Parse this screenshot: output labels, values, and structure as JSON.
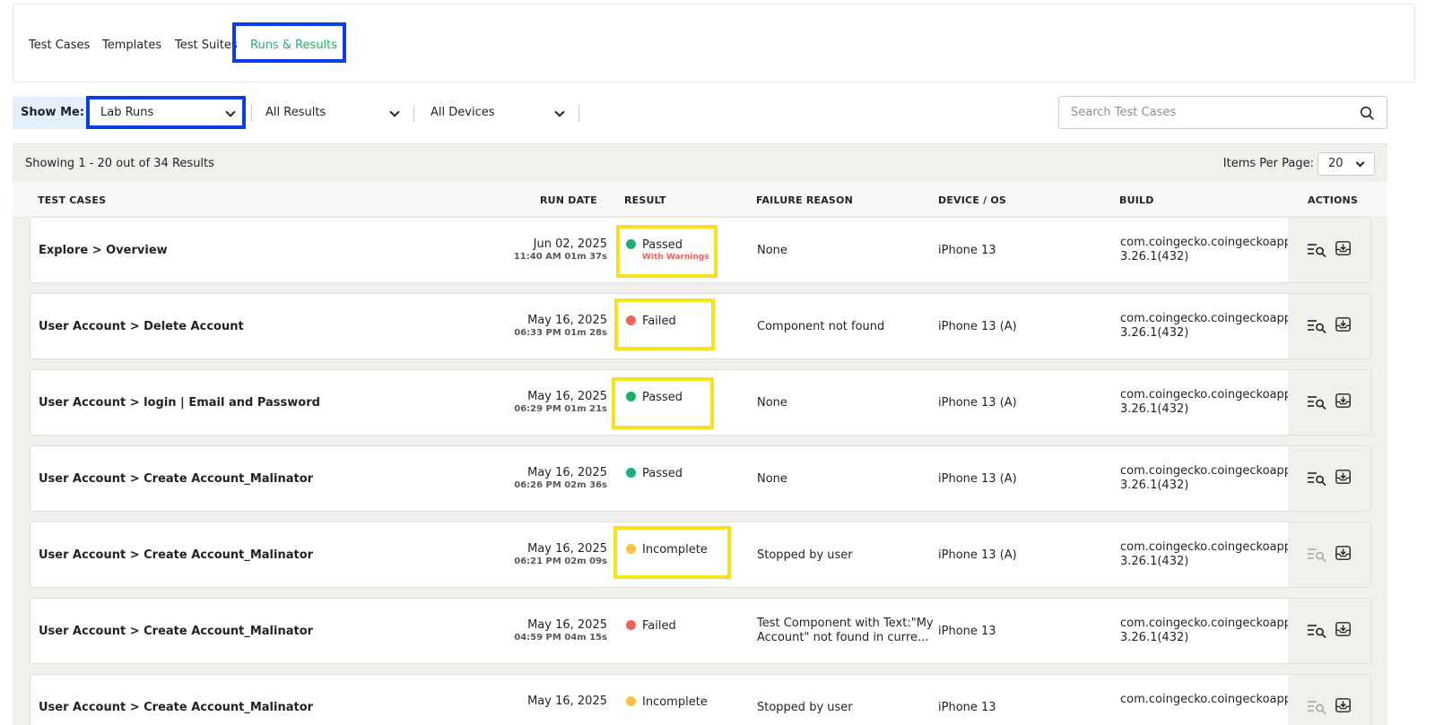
{
  "tabs": [
    {
      "label": "Test Cases",
      "active": false
    },
    {
      "label": "Templates",
      "active": false
    },
    {
      "label": "Test Suites",
      "active": false
    },
    {
      "label": "Runs & Results",
      "active": true
    }
  ],
  "filters": {
    "show_me_label": "Show Me:",
    "run_type": "Lab Runs",
    "results": "All Results",
    "devices": "All Devices",
    "search_placeholder": "Search Test Cases"
  },
  "summary": {
    "showing": "Showing 1 - 20 out of 34 Results",
    "items_per_page_label": "Items Per Page:",
    "items_per_page": "20"
  },
  "columns": {
    "test_cases": "TEST CASES",
    "run_date": "RUN DATE",
    "result": "RESULT",
    "failure_reason": "FAILURE REASON",
    "device_os": "DEVICE / OS",
    "build": "BUILD",
    "actions": "ACTIONS"
  },
  "rows": [
    {
      "name": "Explore > Overview",
      "date": "Jun 02, 2025",
      "time": "11:40 AM 01m 37s",
      "result": "Passed",
      "status": "passed",
      "warning": "With Warnings",
      "reason": "None",
      "device": "iPhone 13",
      "build_line1": "com.coingecko.coingeckoapp",
      "build_line2": "3.26.1(432)",
      "view_enabled": true
    },
    {
      "name": "User Account > Delete Account",
      "date": "May 16, 2025",
      "time": "06:33 PM 01m 28s",
      "result": "Failed",
      "status": "failed",
      "warning": "",
      "reason": "Component not found",
      "device": "iPhone 13 (A)",
      "build_line1": "com.coingecko.coingeckoapp",
      "build_line2": "3.26.1(432)",
      "view_enabled": true
    },
    {
      "name": "User Account > login | Email and Password",
      "date": "May 16, 2025",
      "time": "06:29 PM 01m 21s",
      "result": "Passed",
      "status": "passed",
      "warning": "",
      "reason": "None",
      "device": "iPhone 13 (A)",
      "build_line1": "com.coingecko.coingeckoapp",
      "build_line2": "3.26.1(432)",
      "view_enabled": true
    },
    {
      "name": "User Account > Create Account_Malinator",
      "date": "May 16, 2025",
      "time": "06:26 PM 02m 36s",
      "result": "Passed",
      "status": "passed",
      "warning": "",
      "reason": "None",
      "device": "iPhone 13 (A)",
      "build_line1": "com.coingecko.coingeckoapp",
      "build_line2": "3.26.1(432)",
      "view_enabled": true
    },
    {
      "name": "User Account > Create Account_Malinator",
      "date": "May 16, 2025",
      "time": "06:21 PM 02m 09s",
      "result": "Incomplete",
      "status": "incomplete",
      "warning": "",
      "reason": "Stopped by user",
      "device": "iPhone 13 (A)",
      "build_line1": "com.coingecko.coingeckoapp",
      "build_line2": "3.26.1(432)",
      "view_enabled": false
    },
    {
      "name": "User Account > Create Account_Malinator",
      "date": "May 16, 2025",
      "time": "04:59 PM 04m 15s",
      "result": "Failed",
      "status": "failed",
      "warning": "",
      "reason": "Test Component with Text:\"My Account\" not found in curre...",
      "device": "iPhone 13",
      "build_line1": "com.coingecko.coingeckoapp",
      "build_line2": "3.26.1(432)",
      "view_enabled": true
    },
    {
      "name": "User Account > Create Account_Malinator",
      "date": "May 16, 2025",
      "time": "",
      "result": "Incomplete",
      "status": "incomplete",
      "warning": "",
      "reason": "Stopped by user",
      "device": "iPhone 13",
      "build_line1": "com.coingecko.coingeckoapp",
      "build_line2": "",
      "view_enabled": false
    }
  ],
  "colors": {
    "accent_green": "#21b26b",
    "highlight_blue": "#0a3ee8",
    "highlight_yellow": "#f6e21b",
    "passed": "#17b26a",
    "failed": "#f0625c",
    "incomplete": "#f4c441"
  },
  "icons": {
    "view": "list-search-icon",
    "download": "download-tray-icon",
    "search": "search-icon",
    "chevron": "chevron-down-icon"
  }
}
